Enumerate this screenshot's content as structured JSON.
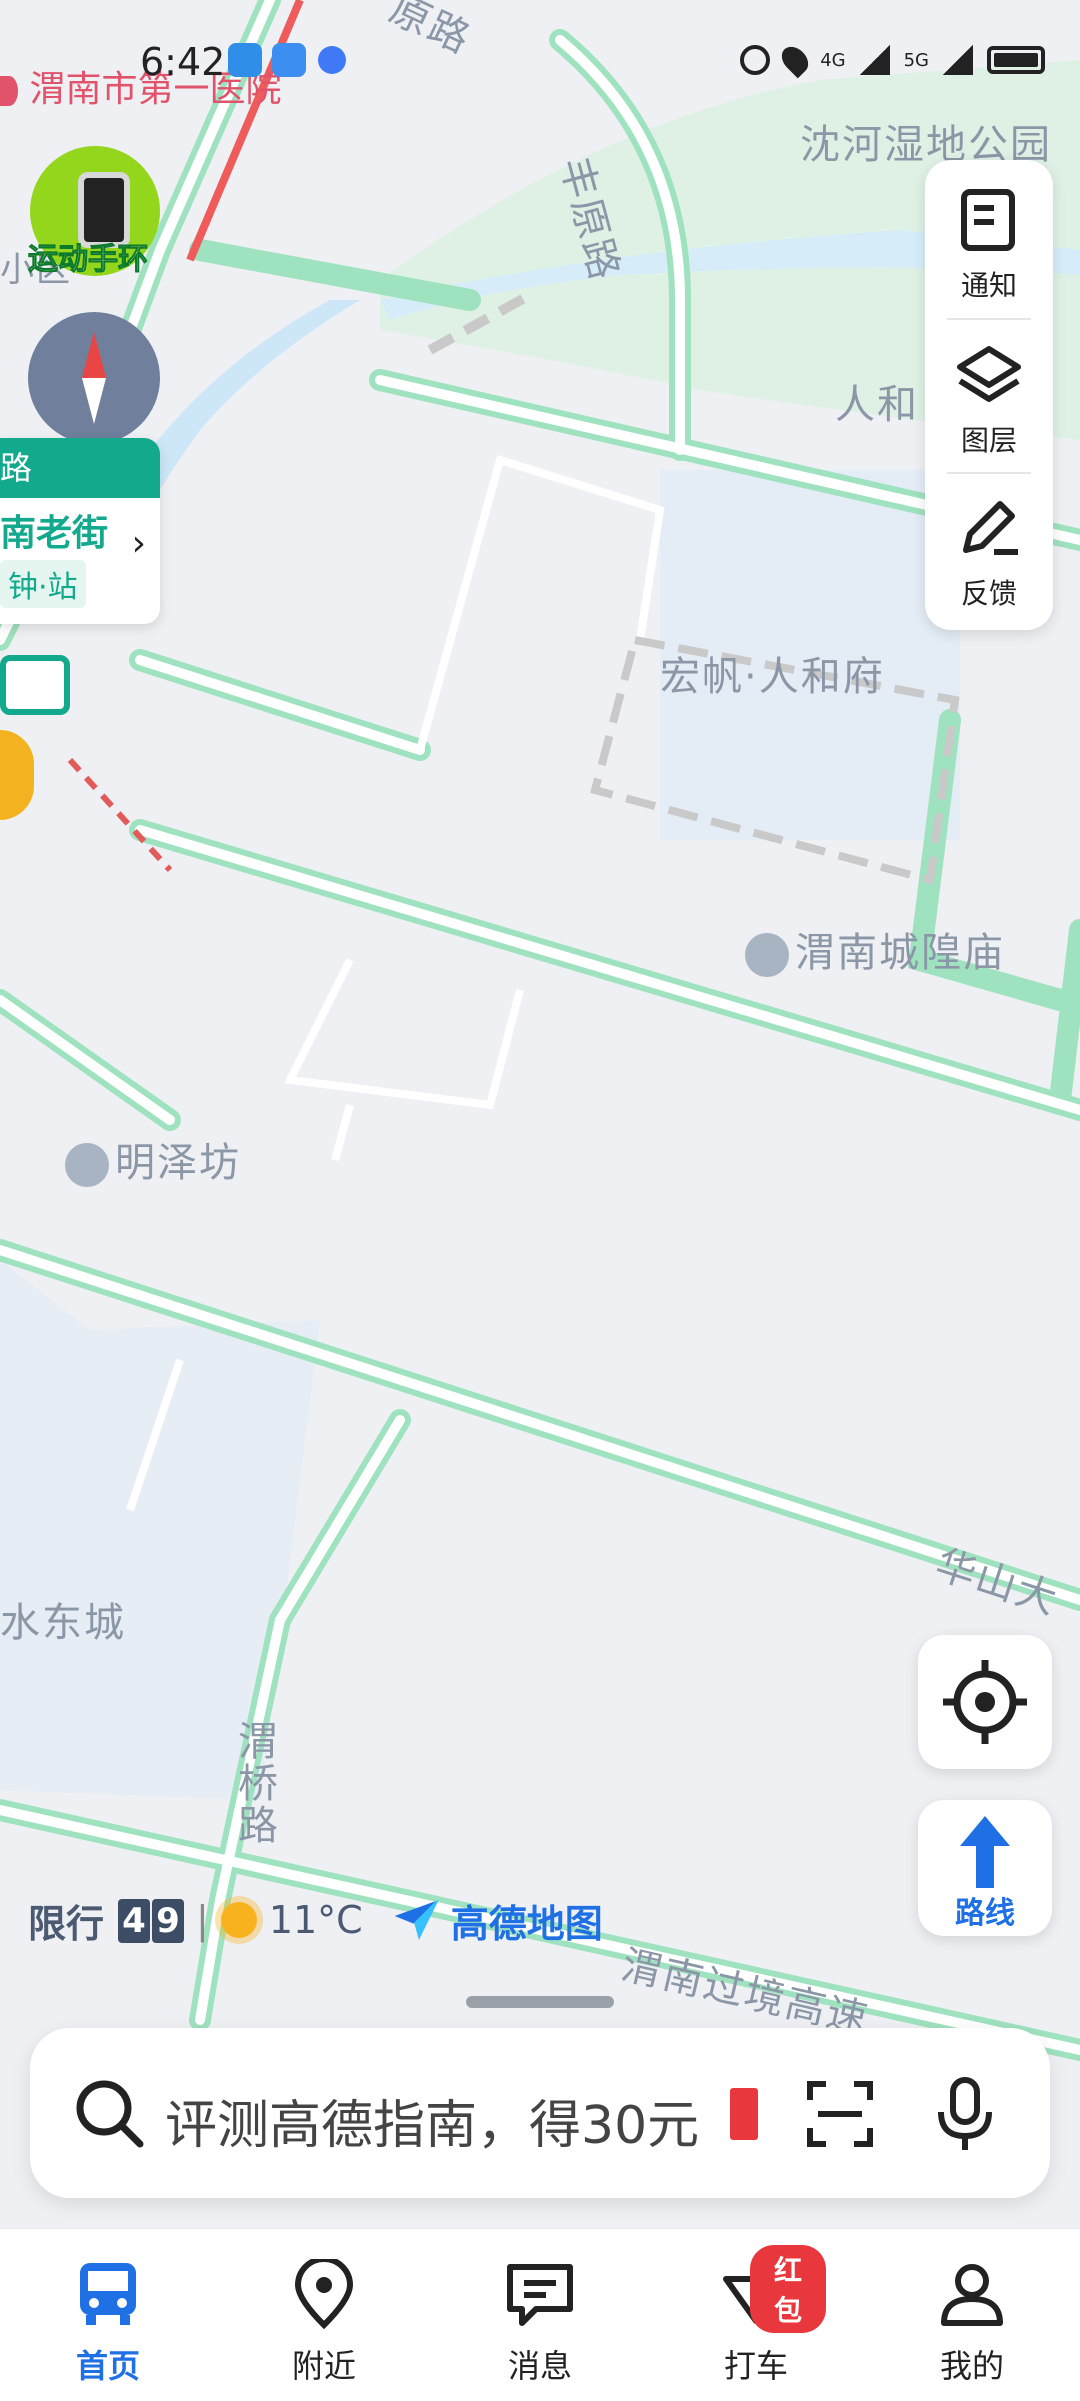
{
  "status_bar": {
    "time": "6:42",
    "hospital_label": "渭南市第一医院",
    "net1": "4G",
    "net2": "5G"
  },
  "map_labels": {
    "park": "沈河湿地公园",
    "road_fengyuan": "丰原路",
    "renhe": "人和",
    "hongfan": "宏帆·人和府",
    "temple": "渭南城隍庙",
    "mingze": "明泽坊",
    "shuidong": "水东城",
    "weiqiao": "渭桥路",
    "huashan": "华山大",
    "guojing": "渭南过境高速",
    "top_road": "原路",
    "xiaoqu": "小区"
  },
  "promo_badge": {
    "label": "运动手环"
  },
  "transit_card": {
    "line_title": "路",
    "station": "南老街",
    "stop_tag": "钟·站"
  },
  "right_panel": {
    "notify": "通知",
    "layers": "图层",
    "feedback": "反馈"
  },
  "route_button": {
    "label": "路线"
  },
  "info_line": {
    "restriction_label": "限行",
    "restriction_num1": "4",
    "restriction_num2": "9",
    "separator": "|",
    "temperature": "11°C",
    "brand": "高德地图"
  },
  "search": {
    "placeholder": "评测高德指南，得30元"
  },
  "tabs": [
    {
      "label": "首页",
      "icon": "bus-icon"
    },
    {
      "label": "附近",
      "icon": "location-pin-icon"
    },
    {
      "label": "消息",
      "icon": "message-icon"
    },
    {
      "label": "打车",
      "icon": "taxi-icon",
      "badge": "红包"
    },
    {
      "label": "我的",
      "icon": "person-icon"
    }
  ],
  "colors": {
    "road_green": "#9fe2bf",
    "accent_blue": "#1f6fe5",
    "transit_green": "#13a98d",
    "badge_red": "#e8373d"
  }
}
